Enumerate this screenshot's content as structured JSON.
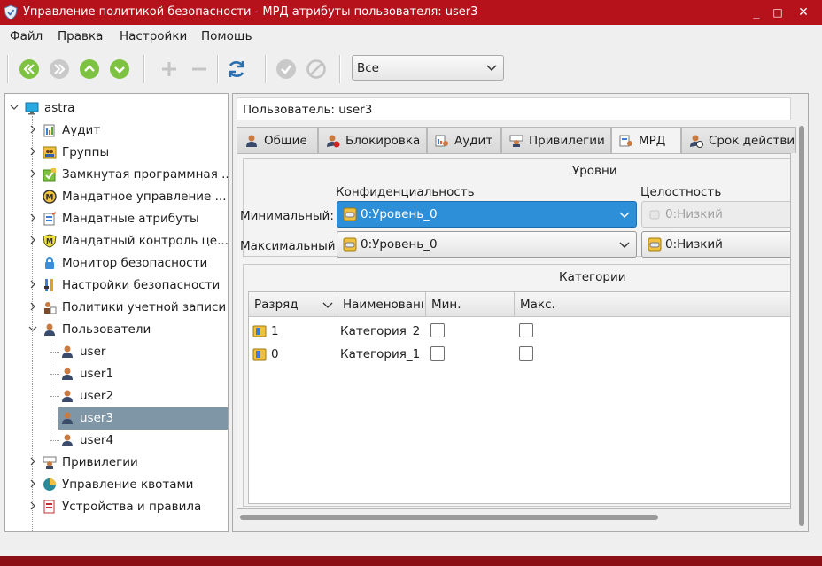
{
  "window": {
    "title": "Управление политикой безопасности - МРД атрибуты пользователя: user3",
    "minimize": "_",
    "maximize": "□",
    "close": "✕"
  },
  "menu": [
    "Файл",
    "Правка",
    "Настройки",
    "Помощь"
  ],
  "toolbar": {
    "buttons": [
      "first-icon",
      "last-icon",
      "up-icon",
      "down-icon",
      "add-icon",
      "remove-icon",
      "refresh-icon",
      "apply-icon",
      "cancel-icon"
    ],
    "filter_value": "Все"
  },
  "tree": {
    "root": "astra",
    "items": [
      "Аудит",
      "Группы",
      "Замкнутая программная ...",
      "Мандатное управление ...",
      "Мандатные атрибуты",
      "Мандатный контроль це...",
      "Монитор безопасности",
      "Настройки безопасности",
      "Политики учетной записи",
      "Пользователи"
    ],
    "users": [
      "user",
      "user1",
      "user2",
      "user3",
      "user4"
    ],
    "selected": "user3",
    "items_after": [
      "Привилегии",
      "Управление квотами",
      "Устройства и правила"
    ]
  },
  "user_field": "Пользователь: user3",
  "tabs": [
    "Общие",
    "Блокировка",
    "Аудит",
    "Привилегии",
    "МРД",
    "Срок действи"
  ],
  "active_tab": "МРД",
  "levels": {
    "title": "Уровни",
    "conf_header": "Конфиденциальность",
    "integ_header": "Целостность",
    "min_label": "Минимальный:",
    "max_label": "Максимальный:",
    "min_conf": "0:Уровень_0",
    "max_conf": "0:Уровень_0",
    "min_integ": "0:Низкий",
    "max_integ": "0:Низкий"
  },
  "categories": {
    "title": "Категории",
    "columns": [
      "Разряд",
      "Наименовани",
      "Мин.",
      "Макс."
    ],
    "rows": [
      {
        "bit": "1",
        "name": "Категория_2",
        "min": false,
        "max": false
      },
      {
        "bit": "0",
        "name": "Категория_1",
        "min": false,
        "max": false
      }
    ]
  },
  "colors": {
    "titlebar": "#b5121b",
    "selection": "#7f96a7",
    "combo_highlight": "#2d8fd8",
    "toolbar_green": "#7ec242"
  }
}
